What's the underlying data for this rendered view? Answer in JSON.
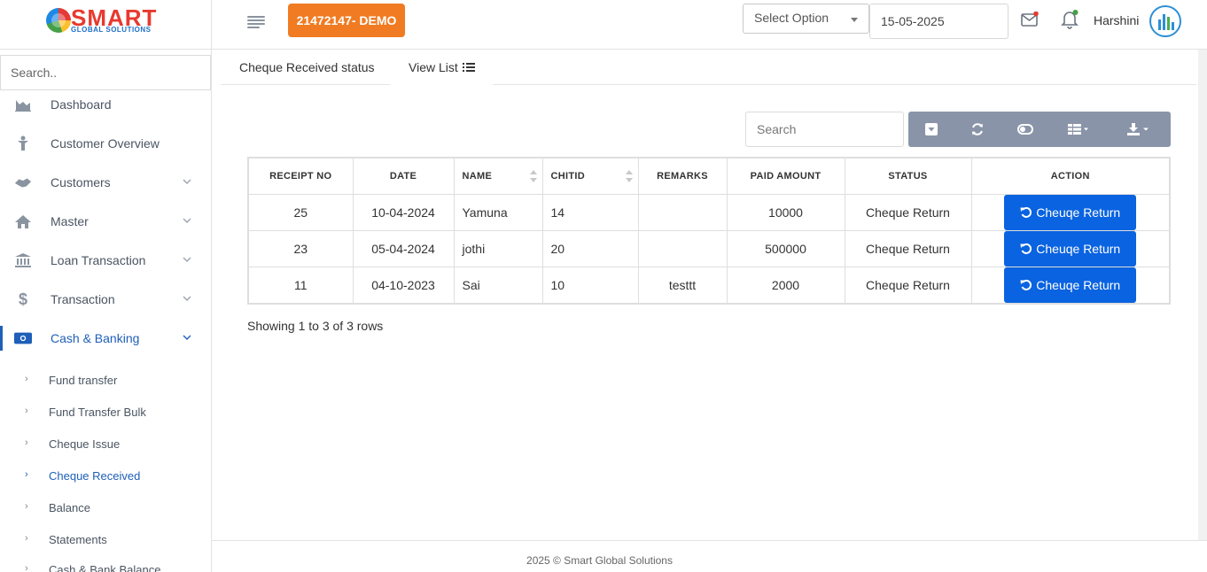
{
  "brand": {
    "name": "SMART",
    "tagline": "GLOBAL SOLUTIONS"
  },
  "sidebar": {
    "search_placeholder": "Search..",
    "items": [
      {
        "label": "Dashboard",
        "icon": "area-chart-icon",
        "expandable": false
      },
      {
        "label": "Customer Overview",
        "icon": "person-icon",
        "expandable": false
      },
      {
        "label": "Customers",
        "icon": "handshake-icon",
        "expandable": true
      },
      {
        "label": "Master",
        "icon": "home-icon",
        "expandable": true
      },
      {
        "label": "Loan Transaction",
        "icon": "bank-icon",
        "expandable": true
      },
      {
        "label": "Transaction",
        "icon": "dollar-icon",
        "expandable": true
      },
      {
        "label": "Cash & Banking",
        "icon": "money-icon",
        "expandable": true,
        "active": true
      }
    ],
    "sub_items": [
      {
        "label": "Fund transfer"
      },
      {
        "label": "Fund Transfer Bulk"
      },
      {
        "label": "Cheque Issue"
      },
      {
        "label": "Cheque Received",
        "active": true
      },
      {
        "label": "Balance"
      },
      {
        "label": "Statements"
      },
      {
        "label": "Cash & Bank Balance"
      }
    ]
  },
  "topbar": {
    "company_button": "21472147- DEMO",
    "select_option": "Select Option",
    "date": "15-05-2025",
    "user_name": "Harshini"
  },
  "tabs": [
    {
      "label": "Cheque Received status"
    },
    {
      "label": "View List"
    }
  ],
  "table_search_placeholder": "Search",
  "table": {
    "headers": [
      "RECEIPT NO",
      "DATE",
      "NAME",
      "CHITID",
      "REMARKS",
      "PAID AMOUNT",
      "STATUS",
      "ACTION"
    ],
    "rows": [
      {
        "receipt_no": "25",
        "date": "10-04-2024",
        "name": "Yamuna",
        "chitid": "14",
        "remarks": "",
        "paid_amount": "10000",
        "status": "Cheque Return",
        "action": "Cheuqe Return"
      },
      {
        "receipt_no": "23",
        "date": "05-04-2024",
        "name": "jothi",
        "chitid": "20",
        "remarks": "",
        "paid_amount": "500000",
        "status": "Cheque Return",
        "action": "Cheuqe Return"
      },
      {
        "receipt_no": "11",
        "date": "04-10-2023",
        "name": "Sai",
        "chitid": "10",
        "remarks": "testtt",
        "paid_amount": "2000",
        "status": "Cheque Return",
        "action": "Cheuqe Return"
      }
    ]
  },
  "pagination_text": "Showing 1 to 3 of 3 rows",
  "footer": "2025 © Smart Global Solutions",
  "colors": {
    "accent": "#0a63e0",
    "orange": "#f07b22",
    "toolbar": "#8a94a8",
    "active_nav": "#1e5fb8"
  }
}
